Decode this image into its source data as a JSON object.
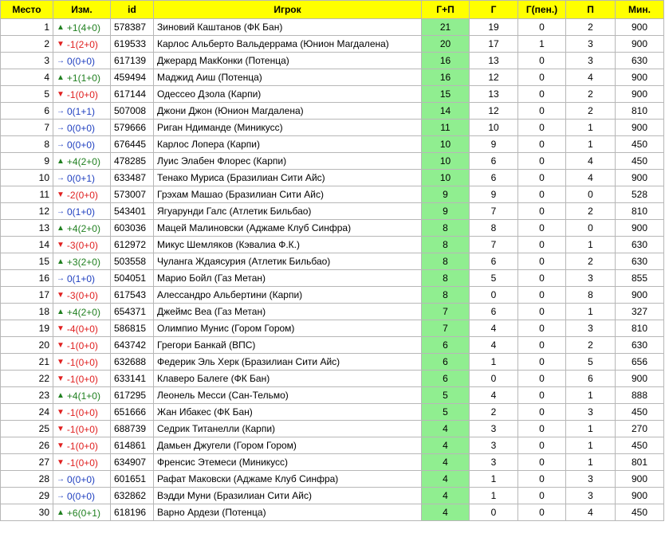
{
  "headers": [
    "Место",
    "Изм.",
    "id",
    "Игрок",
    "Г+П",
    "Г",
    "Г(пен.)",
    "П",
    "Мин."
  ],
  "rows": [
    {
      "place": "1",
      "dir": "up",
      "change": "+1(4+0)",
      "id": "578387",
      "player": "Зиновий Каштанов (ФК Бан)",
      "gp": "21",
      "g": "19",
      "gpen": "0",
      "a": "2",
      "min": "900"
    },
    {
      "place": "2",
      "dir": "down",
      "change": "-1(2+0)",
      "id": "619533",
      "player": "Карлос Альберто Вальдеррама (Юнион Магдалена)",
      "gp": "20",
      "g": "17",
      "gpen": "1",
      "a": "3",
      "min": "900"
    },
    {
      "place": "3",
      "dir": "same",
      "change": "0(0+0)",
      "id": "617139",
      "player": "Джерард МакКонки (Потенца)",
      "gp": "16",
      "g": "13",
      "gpen": "0",
      "a": "3",
      "min": "630"
    },
    {
      "place": "4",
      "dir": "up",
      "change": "+1(1+0)",
      "id": "459494",
      "player": "Маджид Аиш (Потенца)",
      "gp": "16",
      "g": "12",
      "gpen": "0",
      "a": "4",
      "min": "900"
    },
    {
      "place": "5",
      "dir": "down",
      "change": "-1(0+0)",
      "id": "617144",
      "player": "Одессео Дзола (Карпи)",
      "gp": "15",
      "g": "13",
      "gpen": "0",
      "a": "2",
      "min": "900"
    },
    {
      "place": "6",
      "dir": "same",
      "change": "0(1+1)",
      "id": "507008",
      "player": "Джони Джон (Юнион Магдалена)",
      "gp": "14",
      "g": "12",
      "gpen": "0",
      "a": "2",
      "min": "810"
    },
    {
      "place": "7",
      "dir": "same",
      "change": "0(0+0)",
      "id": "579666",
      "player": "Риган Ндиманде (Миникусс)",
      "gp": "11",
      "g": "10",
      "gpen": "0",
      "a": "1",
      "min": "900"
    },
    {
      "place": "8",
      "dir": "same",
      "change": "0(0+0)",
      "id": "676445",
      "player": "Карлос Лопера (Карпи)",
      "gp": "10",
      "g": "9",
      "gpen": "0",
      "a": "1",
      "min": "450"
    },
    {
      "place": "9",
      "dir": "up",
      "change": "+4(2+0)",
      "id": "478285",
      "player": "Луис Элабен Флорес (Карпи)",
      "gp": "10",
      "g": "6",
      "gpen": "0",
      "a": "4",
      "min": "450"
    },
    {
      "place": "10",
      "dir": "same",
      "change": "0(0+1)",
      "id": "633487",
      "player": "Тенако Муриса (Бразилиан Сити Айс)",
      "gp": "10",
      "g": "6",
      "gpen": "0",
      "a": "4",
      "min": "900"
    },
    {
      "place": "11",
      "dir": "down",
      "change": "-2(0+0)",
      "id": "573007",
      "player": "Грэхам Машао (Бразилиан Сити Айс)",
      "gp": "9",
      "g": "9",
      "gpen": "0",
      "a": "0",
      "min": "528"
    },
    {
      "place": "12",
      "dir": "same",
      "change": "0(1+0)",
      "id": "543401",
      "player": "Ягуарунди Галс (Атлетик Бильбао)",
      "gp": "9",
      "g": "7",
      "gpen": "0",
      "a": "2",
      "min": "810"
    },
    {
      "place": "13",
      "dir": "up",
      "change": "+4(2+0)",
      "id": "603036",
      "player": "Мацей Малиновски (Аджаме Клуб Синфра)",
      "gp": "8",
      "g": "8",
      "gpen": "0",
      "a": "0",
      "min": "900"
    },
    {
      "place": "14",
      "dir": "down",
      "change": "-3(0+0)",
      "id": "612972",
      "player": "Микус Шемляков (Кэвалиа Ф.К.)",
      "gp": "8",
      "g": "7",
      "gpen": "0",
      "a": "1",
      "min": "630"
    },
    {
      "place": "15",
      "dir": "up",
      "change": "+3(2+0)",
      "id": "503558",
      "player": "Чуланга Ждаясурия (Атлетик Бильбао)",
      "gp": "8",
      "g": "6",
      "gpen": "0",
      "a": "2",
      "min": "630"
    },
    {
      "place": "16",
      "dir": "same",
      "change": "0(1+0)",
      "id": "504051",
      "player": "Марио Бойл (Газ Метан)",
      "gp": "8",
      "g": "5",
      "gpen": "0",
      "a": "3",
      "min": "855"
    },
    {
      "place": "17",
      "dir": "down",
      "change": "-3(0+0)",
      "id": "617543",
      "player": "Алессандро Альбертини (Карпи)",
      "gp": "8",
      "g": "0",
      "gpen": "0",
      "a": "8",
      "min": "900"
    },
    {
      "place": "18",
      "dir": "up",
      "change": "+4(2+0)",
      "id": "654371",
      "player": "Джеймс Веа (Газ Метан)",
      "gp": "7",
      "g": "6",
      "gpen": "0",
      "a": "1",
      "min": "327"
    },
    {
      "place": "19",
      "dir": "down",
      "change": "-4(0+0)",
      "id": "586815",
      "player": "Олимпио Мунис (Гором Гором)",
      "gp": "7",
      "g": "4",
      "gpen": "0",
      "a": "3",
      "min": "810"
    },
    {
      "place": "20",
      "dir": "down",
      "change": "-1(0+0)",
      "id": "643742",
      "player": "Грегори Банкай (ВПС)",
      "gp": "6",
      "g": "4",
      "gpen": "0",
      "a": "2",
      "min": "630"
    },
    {
      "place": "21",
      "dir": "down",
      "change": "-1(0+0)",
      "id": "632688",
      "player": "Федерик Эль Херк (Бразилиан Сити Айс)",
      "gp": "6",
      "g": "1",
      "gpen": "0",
      "a": "5",
      "min": "656"
    },
    {
      "place": "22",
      "dir": "down",
      "change": "-1(0+0)",
      "id": "633141",
      "player": "Клаверо Балеге (ФК Бан)",
      "gp": "6",
      "g": "0",
      "gpen": "0",
      "a": "6",
      "min": "900"
    },
    {
      "place": "23",
      "dir": "up",
      "change": "+4(1+0)",
      "id": "617295",
      "player": "Леонель Месси (Сан-Тельмо)",
      "gp": "5",
      "g": "4",
      "gpen": "0",
      "a": "1",
      "min": "888"
    },
    {
      "place": "24",
      "dir": "down",
      "change": "-1(0+0)",
      "id": "651666",
      "player": "Жан Ибакес (ФК Бан)",
      "gp": "5",
      "g": "2",
      "gpen": "0",
      "a": "3",
      "min": "450"
    },
    {
      "place": "25",
      "dir": "down",
      "change": "-1(0+0)",
      "id": "688739",
      "player": "Седрик Титанелли (Карпи)",
      "gp": "4",
      "g": "3",
      "gpen": "0",
      "a": "1",
      "min": "270"
    },
    {
      "place": "26",
      "dir": "down",
      "change": "-1(0+0)",
      "id": "614861",
      "player": "Дамьен Джугели (Гором Гором)",
      "gp": "4",
      "g": "3",
      "gpen": "0",
      "a": "1",
      "min": "450"
    },
    {
      "place": "27",
      "dir": "down",
      "change": "-1(0+0)",
      "id": "634907",
      "player": "Френсис Этемеси (Миникусс)",
      "gp": "4",
      "g": "3",
      "gpen": "0",
      "a": "1",
      "min": "801"
    },
    {
      "place": "28",
      "dir": "same",
      "change": "0(0+0)",
      "id": "601651",
      "player": "Рафат Маковски (Аджаме Клуб Синфра)",
      "gp": "4",
      "g": "1",
      "gpen": "0",
      "a": "3",
      "min": "900"
    },
    {
      "place": "29",
      "dir": "same",
      "change": "0(0+0)",
      "id": "632862",
      "player": "Вэдди Муни (Бразилиан Сити Айс)",
      "gp": "4",
      "g": "1",
      "gpen": "0",
      "a": "3",
      "min": "900"
    },
    {
      "place": "30",
      "dir": "up",
      "change": "+6(0+1)",
      "id": "618196",
      "player": "Варно Ардези (Потенца)",
      "gp": "4",
      "g": "0",
      "gpen": "0",
      "a": "4",
      "min": "450"
    }
  ],
  "colors": {
    "header": "#ffff00",
    "gp_highlight": "#90ee90",
    "up": "#208020",
    "down": "#e02020",
    "same": "#2040c0"
  }
}
